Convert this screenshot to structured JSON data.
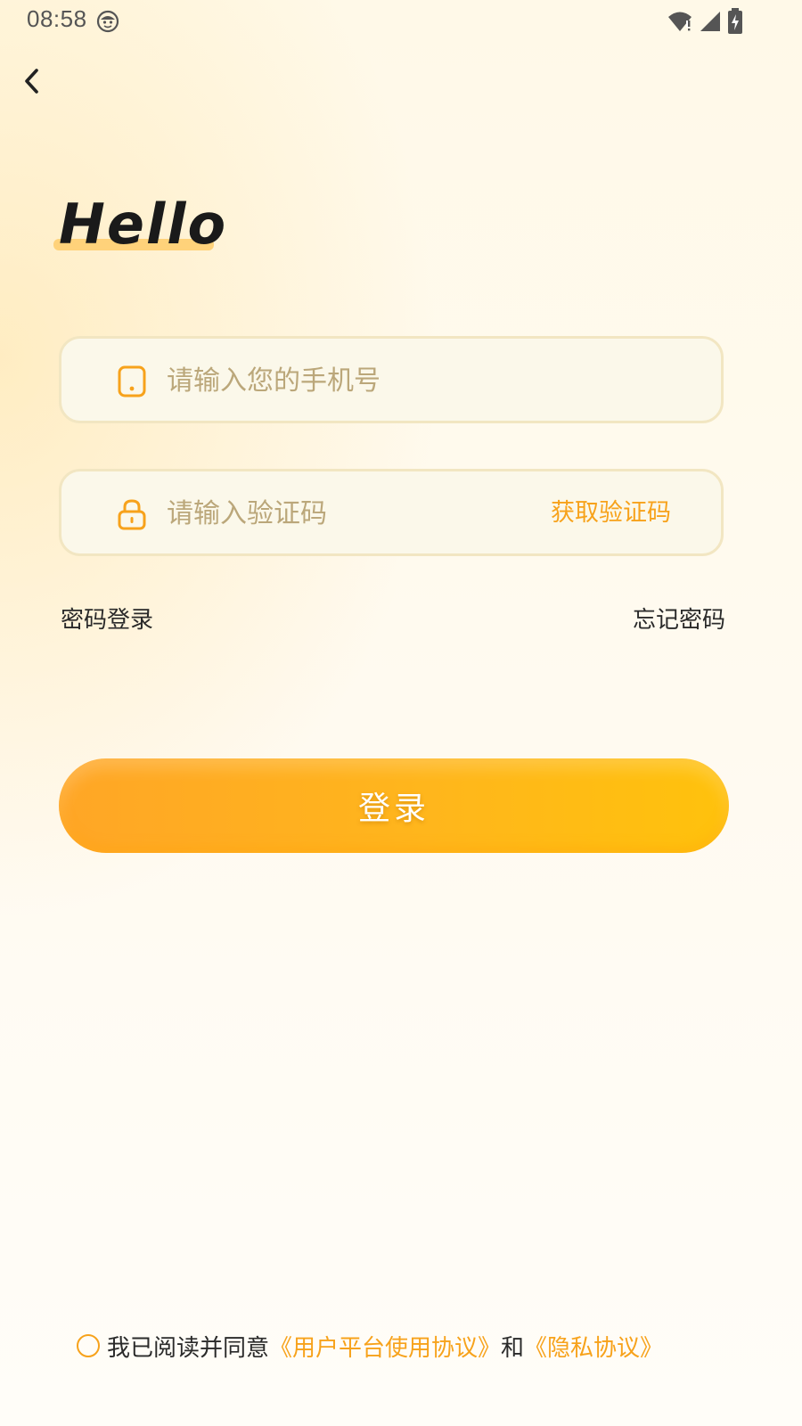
{
  "status_bar": {
    "time": "08:58",
    "icons": [
      "face-notification-icon",
      "wifi-icon",
      "signal-icon",
      "battery-charging-icon"
    ]
  },
  "nav": {
    "back_icon": "chevron-left-icon"
  },
  "greeting": "Hello",
  "phone_field": {
    "icon": "phone-icon",
    "placeholder": "请输入您的手机号",
    "value": ""
  },
  "code_field": {
    "icon": "lock-icon",
    "placeholder": "请输入验证码",
    "value": "",
    "get_code_label": "获取验证码"
  },
  "links": {
    "password_login": "密码登录",
    "forgot_password": "忘记密码"
  },
  "login_button": "登录",
  "agreement": {
    "checked": false,
    "prefix": "我已阅读并同意",
    "user_agreement": "《用户平台使用协议》",
    "conjunction": "和",
    "privacy_agreement": "《隐私协议》"
  },
  "colors": {
    "accent": "#f7a21b",
    "button_start": "#ffa626",
    "button_end": "#ffc20c",
    "field_border": "#f2e6c2",
    "field_bg": "#fbf8ea",
    "placeholder": "#bba77a"
  }
}
